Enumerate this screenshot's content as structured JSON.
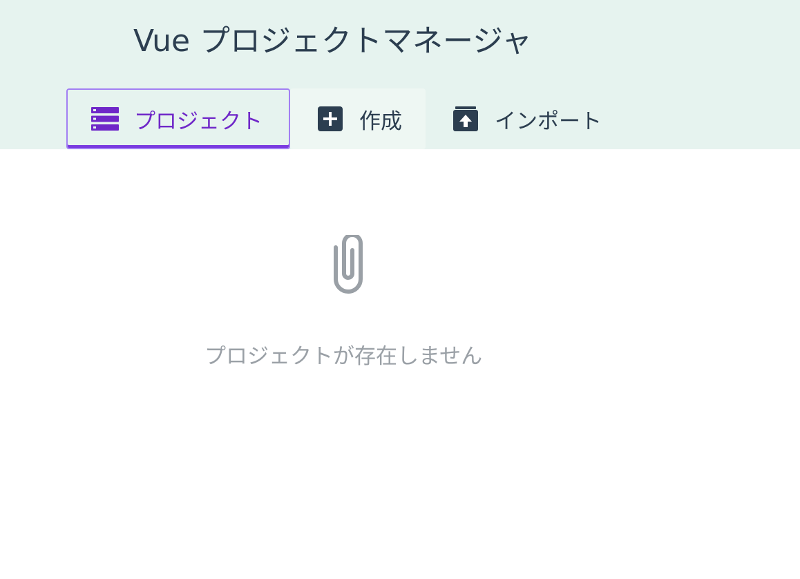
{
  "app": {
    "title": "Vue プロジェクトマネージャ"
  },
  "tabs": [
    {
      "label": "プロジェクト",
      "icon": "list-icon",
      "active": true
    },
    {
      "label": "作成",
      "icon": "add-box-icon",
      "active": false
    },
    {
      "label": "インポート",
      "icon": "unarchive-icon",
      "active": false
    }
  ],
  "empty_state": {
    "icon": "paperclip-icon",
    "message": "プロジェクトが存在しません"
  },
  "colors": {
    "header_bg": "#e6f3ef",
    "accent": "#6f27c8",
    "text": "#2c3e50",
    "muted": "#9aa0a6"
  }
}
